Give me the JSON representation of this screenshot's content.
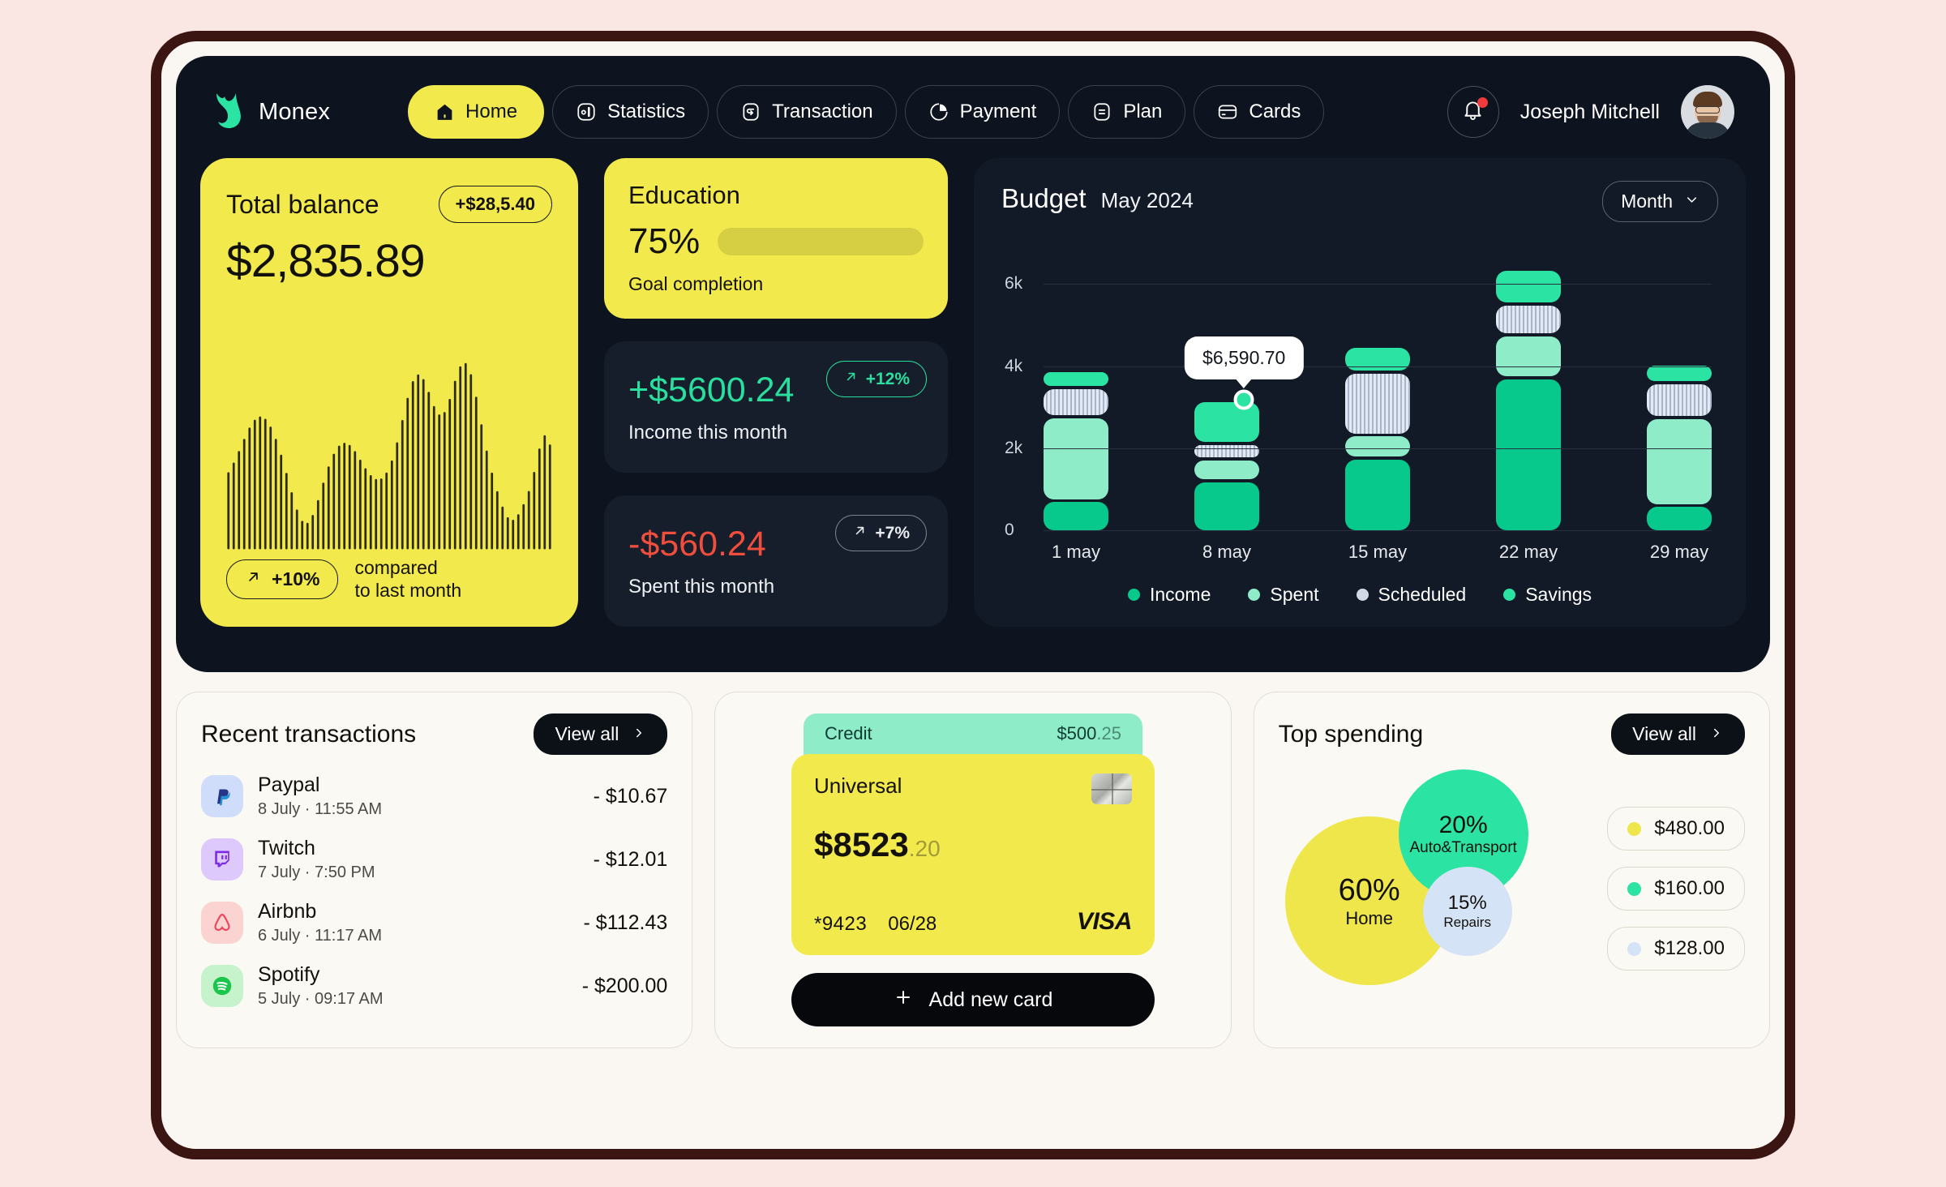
{
  "colors": {
    "page_bg": "#fae7e3",
    "device_border": "#3a1512",
    "panel_dark": "#0d1420",
    "accent_yellow": "#f2ea4c",
    "accent_green": "#2be3a3",
    "income_green": "#06c98b",
    "savings_green": "#8eecc9",
    "scheduled_blue": "#cfd9e8",
    "negative_red": "#ef4e3c"
  },
  "nav": {
    "brand": "Monex",
    "brand_logo_icon": "monex-flame-icon",
    "tabs": [
      {
        "label": "Home",
        "icon": "home-icon",
        "active": true
      },
      {
        "label": "Statistics",
        "icon": "statistics-icon",
        "active": false
      },
      {
        "label": "Transaction",
        "icon": "transaction-icon",
        "active": false
      },
      {
        "label": "Payment",
        "icon": "payment-pie-icon",
        "active": false
      },
      {
        "label": "Plan",
        "icon": "plan-list-icon",
        "active": false
      },
      {
        "label": "Cards",
        "icon": "cards-icon",
        "active": false
      }
    ],
    "notification_icon": "bell-icon",
    "has_notification": true,
    "user_name": "Joseph Mitchell",
    "avatar_icon": "user-avatar"
  },
  "balance": {
    "label": "Total balance",
    "change_pill": "+$28,5.40",
    "amount": "$2,835.89",
    "footer_pill": "+10%",
    "footer_arrow_icon": "arrow-up-right-icon",
    "footer_line1": "compared",
    "footer_line2": "to last month"
  },
  "education": {
    "title": "Education",
    "percent_label": "75%",
    "progress_percent": 75,
    "subtitle": "Goal completion"
  },
  "stats": [
    {
      "amount": "+$5600.24",
      "tone": "green",
      "pill": "+12%",
      "pill_tone": "green",
      "arrow_icon": "arrow-up-right-icon",
      "subtitle": "Income this month"
    },
    {
      "amount": "-$560.24",
      "tone": "red",
      "pill": "+7%",
      "pill_tone": "grey",
      "arrow_icon": "arrow-up-right-icon",
      "subtitle": "Spent  this month"
    }
  ],
  "budget": {
    "title": "Budget",
    "month": "May 2024",
    "range_selector": "Month",
    "range_icon": "chevron-down-icon",
    "tooltip_value": "$6,590.70",
    "tooltip_on_category": "8 may",
    "legend": [
      {
        "label": "Income",
        "color": "#06c98b"
      },
      {
        "label": "Spent",
        "color": "#8eecc9"
      },
      {
        "label": "Scheduled",
        "color": "#cfd9e8"
      },
      {
        "label": "Savings",
        "color": "#2be3a3"
      }
    ]
  },
  "chart_data": {
    "type": "bar",
    "title": "Budget",
    "subtitle": "May 2024",
    "stacked": true,
    "categories": [
      "1 may",
      "8 may",
      "15 may",
      "22 may",
      "29 may"
    ],
    "xlabel": "",
    "ylabel": "",
    "ylim": [
      0,
      6800
    ],
    "yticks": [
      0,
      2000,
      4000,
      6000
    ],
    "ytick_labels": [
      "0",
      "2k",
      "4k",
      "6k"
    ],
    "grid": true,
    "legend_position": "bottom",
    "series": [
      {
        "name": "Income",
        "color": "#06c98b",
        "values": [
          760,
          1250,
          1800,
          3750,
          640
        ]
      },
      {
        "name": "Spent",
        "color": "#8eecc9",
        "values": [
          2050,
          520,
          560,
          1050,
          2150
        ]
      },
      {
        "name": "Scheduled",
        "color": "#cfd9e8",
        "values": [
          700,
          380,
          1530,
          760,
          850
        ]
      },
      {
        "name": "Savings",
        "color": "#2be3a3",
        "values": [
          420,
          1040,
          640,
          850,
          450
        ]
      }
    ],
    "annotation": {
      "label": "$6,590.70",
      "category": "8 may"
    }
  },
  "recent_transactions": {
    "title": "Recent transactions",
    "view_all": "View all",
    "view_all_icon": "chevron-right-icon",
    "items": [
      {
        "name": "Paypal",
        "date": "8 July",
        "time": "11:55 AM",
        "amount": "- $10.67",
        "icon": "paypal-icon",
        "icon_bg": "#cfdcfa",
        "icon_fg": "#1b4ca8"
      },
      {
        "name": "Twitch",
        "date": "7 July",
        "time": "7:50 PM",
        "amount": "- $12.01",
        "icon": "twitch-icon",
        "icon_bg": "#ddc9fb",
        "icon_fg": "#7d2ae8"
      },
      {
        "name": "Airbnb",
        "date": "6 July",
        "time": "11:17 AM",
        "amount": "- $112.43",
        "icon": "airbnb-icon",
        "icon_bg": "#fbd3d0",
        "icon_fg": "#f0445e"
      },
      {
        "name": "Spotify",
        "date": "5 July",
        "time": "09:17 AM",
        "amount": "- $200.00",
        "icon": "spotify-icon",
        "icon_bg": "#c6f3cc",
        "icon_fg": "#19c64a"
      }
    ]
  },
  "card_widget": {
    "credit_label": "Credit",
    "credit_amount_main": "$500",
    "credit_amount_cents": ".25",
    "card_name": "Universal",
    "chip_icon": "emv-chip-icon",
    "balance_main": "$8523",
    "balance_cents": ".20",
    "card_number": "*9423",
    "expiry": "06/28",
    "brand": "VISA",
    "add_card_label": "Add new card",
    "add_icon": "plus-icon"
  },
  "top_spending": {
    "title": "Top spending",
    "view_all": "View all",
    "view_all_icon": "chevron-right-icon",
    "bubbles": [
      {
        "percent": "60%",
        "label": "Home",
        "color": "#eee64a"
      },
      {
        "percent": "20%",
        "label": "Auto&Transport",
        "color": "#2be3a3"
      },
      {
        "percent": "15%",
        "label": "Repairs",
        "color": "#d5e3f6"
      }
    ],
    "amounts": [
      {
        "value": "$480.00",
        "color": "#eee64a"
      },
      {
        "value": "$160.00",
        "color": "#2be3a3"
      },
      {
        "value": "$128.00",
        "color": "#d5e3f6"
      }
    ]
  }
}
